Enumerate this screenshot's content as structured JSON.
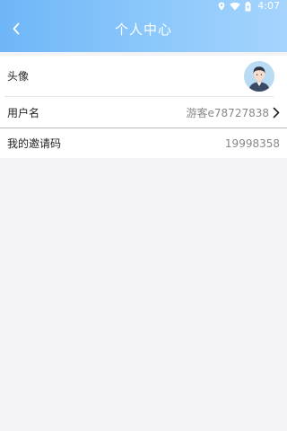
{
  "status_bar": {
    "time": "4:07",
    "icons": [
      "location-icon",
      "wifi-icon",
      "battery-icon"
    ]
  },
  "header": {
    "title": "个人中心",
    "back_icon": "chevron-left-icon",
    "gradient_colors": [
      "#6fb6f7",
      "#a5d4fd"
    ]
  },
  "profile": {
    "avatar_label": "头像",
    "username_label": "用户名",
    "username_value": "游客e78727838",
    "invite_label": "我的邀请码",
    "invite_value": "19998358"
  }
}
